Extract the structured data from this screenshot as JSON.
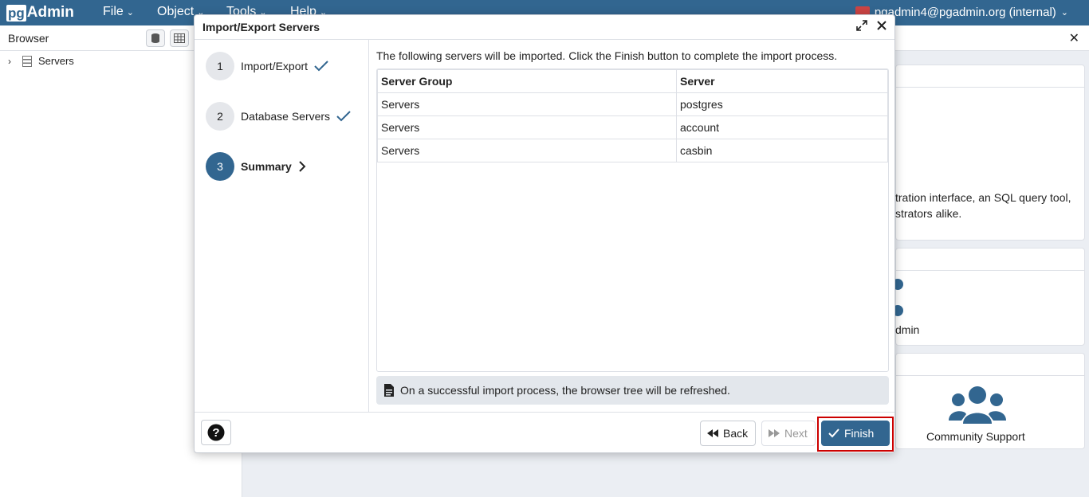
{
  "app": {
    "logo_pg": "pg",
    "logo_admin": "Admin",
    "menus": [
      "File",
      "Object",
      "Tools",
      "Help"
    ],
    "user": "pgadmin4@pgadmin.org (internal)"
  },
  "browser": {
    "title": "Browser",
    "tree": [
      {
        "label": "Servers"
      }
    ]
  },
  "background": {
    "welcome_text_1": "tration interface, an SQL query tool,",
    "welcome_text_2": "strators alike.",
    "admin_text": "dmin",
    "community_support": "Community Support"
  },
  "dialog": {
    "title": "Import/Export Servers",
    "steps": [
      {
        "number": "1",
        "label": "Import/Export",
        "state": "done"
      },
      {
        "number": "2",
        "label": "Database Servers",
        "state": "done"
      },
      {
        "number": "3",
        "label": "Summary",
        "state": "active"
      }
    ],
    "intro": "The following servers will be imported. Click the Finish button to complete the import process.",
    "table": {
      "headers": [
        "Server Group",
        "Server"
      ],
      "rows": [
        [
          "Servers",
          "postgres"
        ],
        [
          "Servers",
          "account"
        ],
        [
          "Servers",
          "casbin"
        ]
      ]
    },
    "note": "On a successful import process, the browser tree will be refreshed.",
    "buttons": {
      "back": "Back",
      "next": "Next",
      "finish": "Finish"
    }
  },
  "colors": {
    "primary": "#326690",
    "highlight_outline": "#cc0000"
  }
}
